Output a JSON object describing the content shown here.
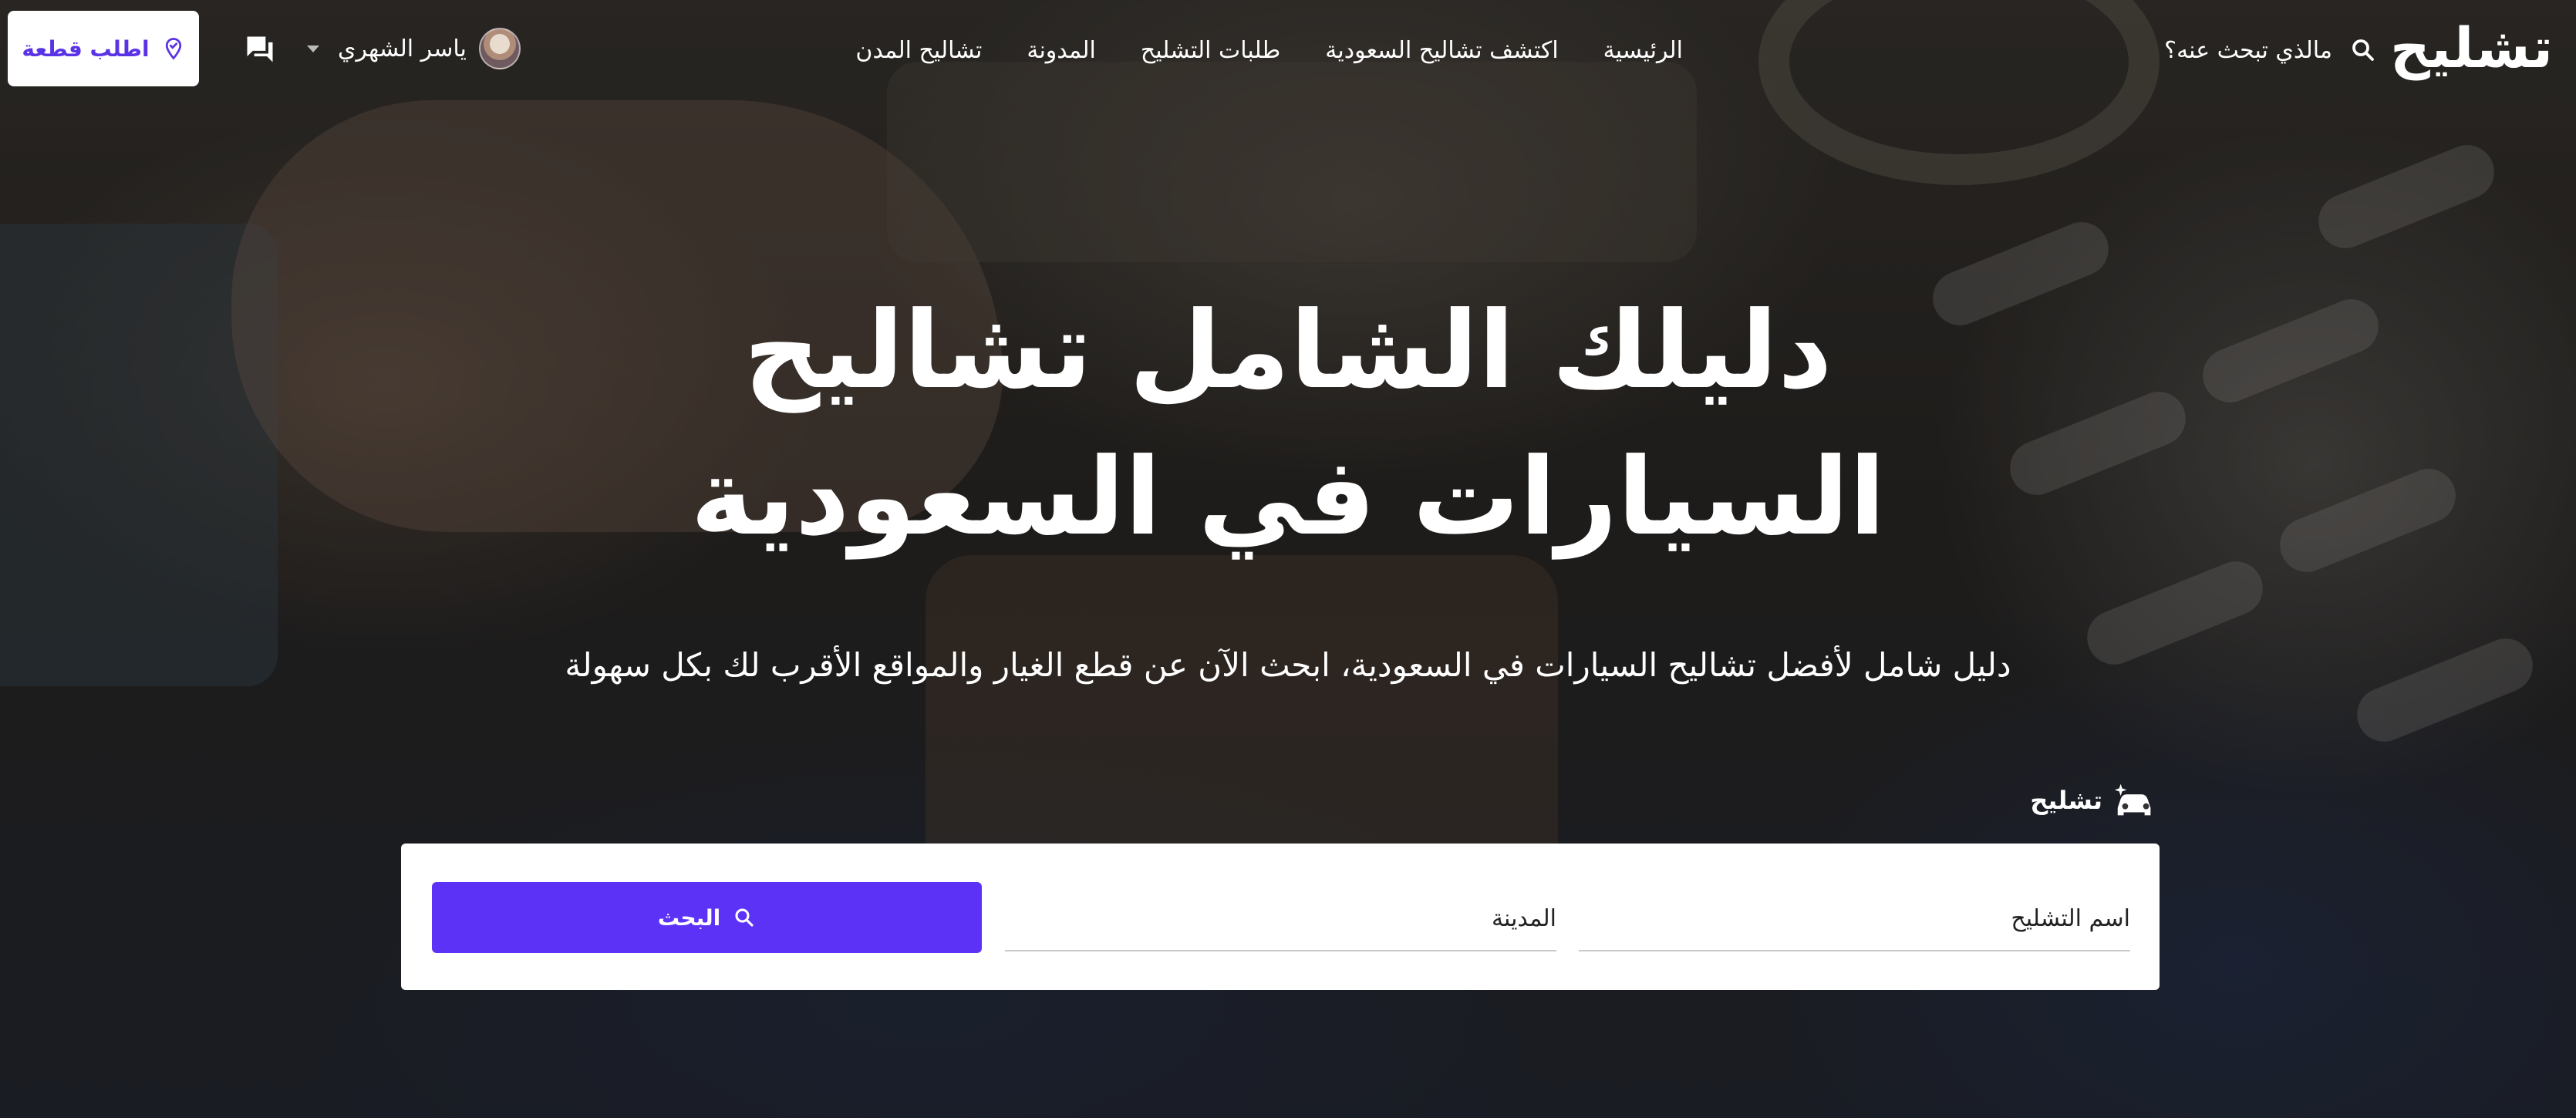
{
  "brand": {
    "logo_text": "تشليح"
  },
  "header": {
    "search_label": "مالذي تبحث عنه؟",
    "nav": [
      {
        "label": "الرئيسية"
      },
      {
        "label": "اكتشف تشاليح السعودية"
      },
      {
        "label": "طلبات التشليح"
      },
      {
        "label": "المدونة"
      },
      {
        "label": "تشاليح المدن"
      }
    ],
    "user_name": "ياسر الشهري",
    "order_button": "اطلب قطعة"
  },
  "hero": {
    "title_line1": "دليلك الشامل تشاليح",
    "title_line2": "السيارات في السعودية",
    "subtitle": "دليل شامل لأفضل تشاليح السيارات في السعودية، ابحث الآن عن قطع الغيار والمواقع الأقرب لك بكل سهولة"
  },
  "search": {
    "tag_label": "تشليح",
    "name_placeholder": "اسم التشليح",
    "city_placeholder": "المدينة",
    "button_label": "البحث"
  },
  "colors": {
    "accent": "#5c33f6",
    "order_text": "#5b33e6"
  },
  "icons": {
    "search": "search-icon",
    "chat": "chat-icon",
    "location": "location-pin-icon",
    "car": "car-sparkle-icon"
  }
}
